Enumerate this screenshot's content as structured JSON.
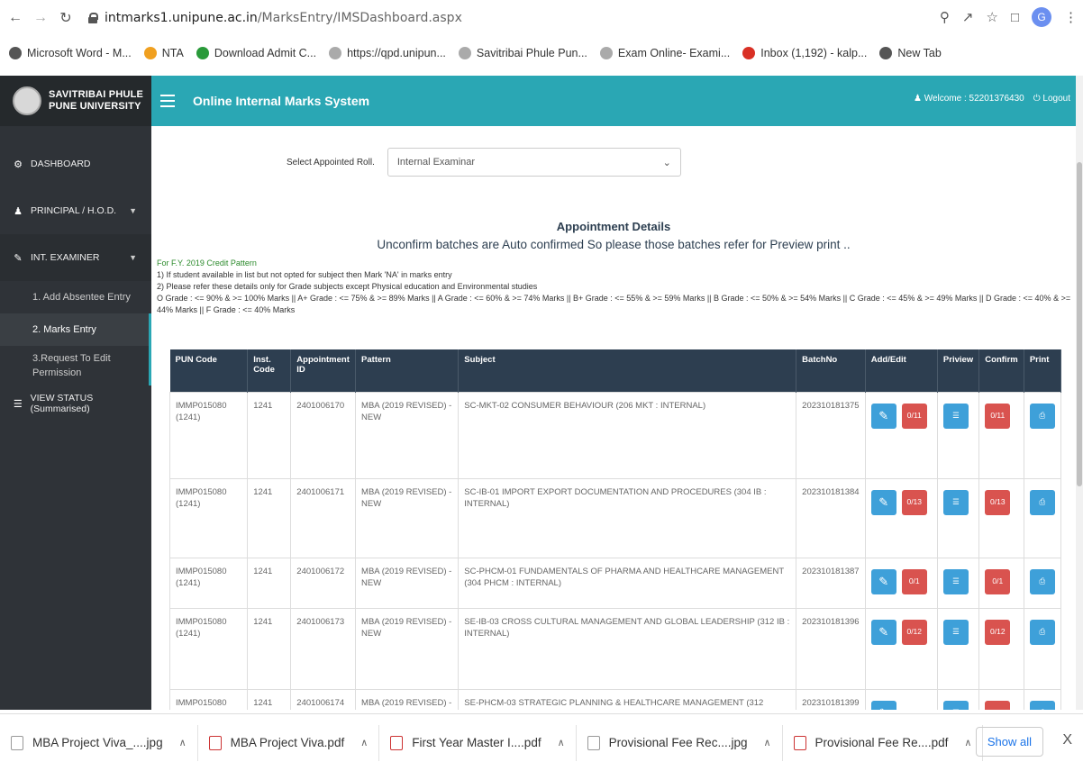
{
  "browser": {
    "url_host": "intmarks1.unipune.ac.in",
    "url_path": "/MarksEntry/IMSDashboard.aspx",
    "profile_initial": "G",
    "bookmarks": [
      {
        "label": "Microsoft Word - M...",
        "icon": "globe-icon",
        "color": "#555"
      },
      {
        "label": "NTA",
        "icon": "nta-icon",
        "color": "#f0a020"
      },
      {
        "label": "Download Admit C...",
        "icon": "flag-icon",
        "color": "#2a9a3a"
      },
      {
        "label": "https://qpd.unipun...",
        "icon": "seal-icon",
        "color": "#aaa"
      },
      {
        "label": "Savitribai Phule Pun...",
        "icon": "seal-icon",
        "color": "#aaa"
      },
      {
        "label": "Exam Online- Exami...",
        "icon": "seal-icon",
        "color": "#aaa"
      },
      {
        "label": "Inbox (1,192) - kalp...",
        "icon": "gmail-icon",
        "color": "#d93025"
      },
      {
        "label": "New Tab",
        "icon": "globe-icon",
        "color": "#555"
      }
    ]
  },
  "app": {
    "university_line1": "SAVITRIBAI PHULE",
    "university_line2": "PUNE UNIVERSITY",
    "title": "Online Internal Marks System",
    "welcome": "Welcome : 52201376430",
    "logout": "Logout",
    "accent": "#2aa7b4"
  },
  "sidebar": {
    "dashboard": "DASHBOARD",
    "principal": "PRINCIPAL / H.O.D.",
    "int_examiner": "INT. EXAMINER",
    "sub": [
      "1. Add Absentee Entry",
      "2. Marks Entry",
      "3.Request To Edit Permission"
    ],
    "view_status": "VIEW STATUS (Summarised)"
  },
  "main": {
    "select_label": "Select Appointed Roll.",
    "select_value": "Internal Examinar",
    "appt_heading": "Appointment Details",
    "appt_note": "Unconfirm batches are Auto confirmed So please those batches refer for Preview print ..",
    "pattern_note": "For F.Y. 2019 Credit Pattern",
    "note1": "1) If student available in list but not opted for subject then Mark 'NA' in marks entry",
    "note2": "2) Please refer these details only for Grade subjects except Physical education and Environmental studies",
    "note3": "O Grade : <= 90% & >= 100% Marks || A+ Grade : <= 75% & >= 89% Marks || A Grade : <= 60% & >= 74% Marks || B+ Grade : <= 55% & >= 59% Marks || B Grade : <= 50% & >= 54% Marks || C Grade : <= 45% & >= 49% Marks || D Grade : <= 40% & >= 44% Marks || F Grade : <= 40% Marks"
  },
  "table": {
    "headers": [
      "PUN Code",
      "Inst. Code",
      "Appointment ID",
      "Pattern",
      "Subject",
      "BatchNo",
      "Add/Edit",
      "Priview",
      "Confirm",
      "Print"
    ],
    "rows": [
      {
        "pun": "IMMP015080 (1241)",
        "inst": "1241",
        "appt": "2401006170",
        "pattern": "MBA (2019 REVISED) - NEW",
        "subject": "SC-MKT-02 CONSUMER BEHAVIOUR (206 MKT : INTERNAL)",
        "batch": "202310181375",
        "edit_count": "0/11",
        "confirm": "0/11"
      },
      {
        "pun": "IMMP015080 (1241)",
        "inst": "1241",
        "appt": "2401006171",
        "pattern": "MBA (2019 REVISED) - NEW",
        "subject": "SC-IB-01 IMPORT EXPORT DOCUMENTATION AND PROCEDURES (304 IB : INTERNAL)",
        "batch": "202310181384",
        "edit_count": "0/13",
        "confirm": "0/13"
      },
      {
        "pun": "IMMP015080 (1241)",
        "inst": "1241",
        "appt": "2401006172",
        "pattern": "MBA (2019 REVISED) - NEW",
        "subject": "SC-PHCM-01 FUNDAMENTALS OF PHARMA AND HEALTHCARE MANAGEMENT (304 PHCM : INTERNAL)",
        "batch": "202310181387",
        "edit_count": "0/1",
        "confirm": "0/1"
      },
      {
        "pun": "IMMP015080 (1241)",
        "inst": "1241",
        "appt": "2401006173",
        "pattern": "MBA (2019 REVISED) - NEW",
        "subject": "SE-IB-03 CROSS CULTURAL MANAGEMENT AND GLOBAL LEADERSHIP (312 IB : INTERNAL)",
        "batch": "202310181396",
        "edit_count": "0/12",
        "confirm": "0/12"
      },
      {
        "pun": "IMMP015080",
        "inst": "1241",
        "appt": "2401006174",
        "pattern": "MBA (2019 REVISED) -",
        "subject": "SE-PHCM-03 STRATEGIC PLANNING & HEALTHCARE MANAGEMENT (312 PHCM :",
        "batch": "202310181399",
        "edit_count": "",
        "confirm": ""
      }
    ]
  },
  "downloads": [
    {
      "name": "MBA Project Viva_....jpg",
      "type": "image"
    },
    {
      "name": "MBA Project Viva.pdf",
      "type": "pdf"
    },
    {
      "name": "First Year Master I....pdf",
      "type": "pdf"
    },
    {
      "name": "Provisional Fee Rec....jpg",
      "type": "image"
    },
    {
      "name": "Provisional Fee Re....pdf",
      "type": "pdf"
    }
  ],
  "download_bar": {
    "show_all": "Show all",
    "close": "X"
  }
}
